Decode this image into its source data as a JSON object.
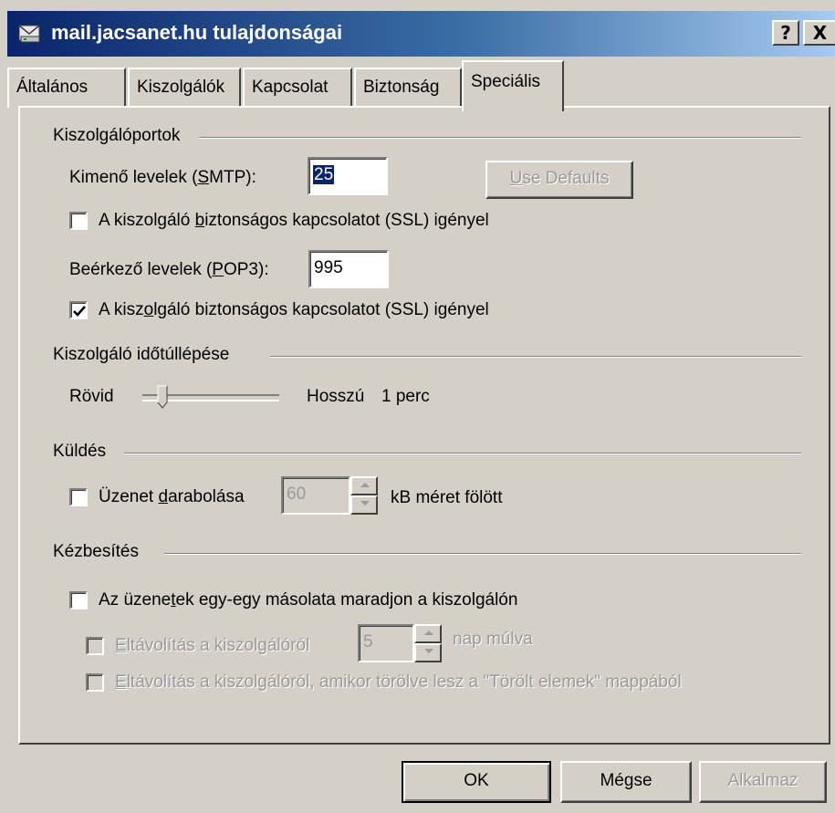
{
  "window": {
    "title": "mail.jacsanet.hu tulajdonságai",
    "help_button": "?",
    "close_button": "X"
  },
  "tabs": [
    {
      "label": "Általános",
      "active": false
    },
    {
      "label": "Kiszolgálók",
      "active": false
    },
    {
      "label": "Kapcsolat",
      "active": false
    },
    {
      "label": "Biztonság",
      "active": false
    },
    {
      "label": "Speciális",
      "active": true
    }
  ],
  "server_ports": {
    "group_title": "Kiszolgálóportok",
    "smtp_label_pre": "Kimenő levelek (",
    "smtp_label_key": "S",
    "smtp_label_post": "MTP):",
    "smtp_value": "25",
    "use_defaults_key": "U",
    "use_defaults_rest": "se Defaults",
    "smtp_ssl_pre": "A kiszolgáló ",
    "smtp_ssl_key": "b",
    "smtp_ssl_post": "iztonságos kapcsolatot (SSL) igényel",
    "smtp_ssl_checked": false,
    "pop3_label_pre": "Beérkező levelek (",
    "pop3_label_key": "P",
    "pop3_label_post": "OP3):",
    "pop3_value": "995",
    "pop3_ssl_pre": "A kisz",
    "pop3_ssl_key": "o",
    "pop3_ssl_post": "lgáló biztonságos kapcsolatot (SSL) igényel",
    "pop3_ssl_checked": true
  },
  "timeout": {
    "group_title": "Kiszolgáló időtúllépése",
    "short_label": "Rövid",
    "long_label": "Hosszú",
    "value_text": "1 perc"
  },
  "sending": {
    "group_title": "Küldés",
    "split_pre": "Üzenet ",
    "split_key": "d",
    "split_post": "arabolása",
    "split_checked": false,
    "split_value": "60",
    "split_unit": "kB méret fölött"
  },
  "delivery": {
    "group_title": "Kézbesítés",
    "leave_copy_pre": "Az üzene",
    "leave_copy_key": "t",
    "leave_copy_post": "ek egy-egy másolata maradjon a kiszolgálón",
    "leave_copy_checked": false,
    "remove_after_key": "E",
    "remove_after_rest": "ltávolítás a kiszolgálóról",
    "remove_after_days": "5",
    "remove_after_unit": "nap múlva",
    "remove_deleted_key": "E",
    "remove_deleted_rest": "ltávolítás a kiszolgálóról, amikor törölve lesz a \"Törölt elemek\" mappából"
  },
  "buttons": {
    "ok": "OK",
    "cancel": "Mégse",
    "apply": "Alkalmaz"
  }
}
